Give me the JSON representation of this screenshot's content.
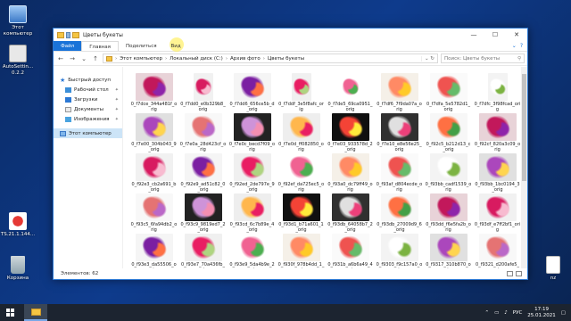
{
  "desktop": {
    "icons": [
      {
        "label": "Этот компьютер"
      },
      {
        "label": "AutoSettin... 0.2.2"
      },
      {
        "label": "TS.21.1.144..."
      },
      {
        "label": "Корзина"
      },
      {
        "label": "nz"
      }
    ]
  },
  "window": {
    "title": "Цветы букеты",
    "controls": {
      "minimize": "—",
      "maximize": "☐",
      "close": "✕"
    },
    "ribbon_tabs": [
      "Файл",
      "Главная",
      "Поделиться",
      "Вид"
    ],
    "address": {
      "segments": [
        "Этот компьютер",
        "Локальный диск (C:)",
        "Архив фото",
        "Цветы букеты"
      ],
      "separator": "›"
    },
    "search": {
      "placeholder": "Поиск: Цветы букеты"
    },
    "nav": {
      "quick_access": "Быстрый доступ",
      "items": [
        "Рабочий стол",
        "Загрузки",
        "Документы",
        "Изображения"
      ],
      "this_pc": "Этот компьютер"
    },
    "files": [
      "0_f7dce_344a481f_orig",
      "0_f7dd0_e0b329b8_orig",
      "0_f7dd6_656ce5b_d_orig",
      "0_f7ddf_3e5f8afc_orig",
      "0_f7de5_69ca0951_orig",
      "0_f7df6_7f9da07a_orig",
      "0_f7dfa_5e5782d1_orig",
      "0_f7dfc_3f98fcad_orig",
      "0_f7e00_304b043_9_orig",
      "0_f7e0a_28d423cf_orig",
      "0_f7e0c_becd7f09_orig",
      "0_f7e0d_ff082850_orig",
      "0_f7e03_933578d_2_orig",
      "0_f7e10_e8e56e25_orig",
      "0_f92c5_b212d13_c_orig",
      "0_f92cf_820a3c09_orig",
      "0_f92e3_cb2a691_b_orig",
      "0_f92e9_ad51c82_0_orig",
      "0_f92ed_2de797e_9_orig",
      "0_f92ef_da725ec5_orig",
      "0_f93a0_dc79ff49_orig",
      "0_f93af_d804ecde_orig",
      "0_f93bb_cadf1539_orig",
      "0_f93bb_1bc0194_3_orig",
      "0_f93c5_6fa94db2_orig",
      "0_f93c9_9819ed7_2_orig",
      "0_f93cd_6c7b89e_4_orig",
      "0_f93d1_b71a601_1_orig",
      "0_f93db_64058b7_2_orig",
      "0_f93db_27009d9_6_orig",
      "0_f93dd_f6e5fa2b_orig",
      "0_f93df_e7ff2bf1_orig",
      "0_f93e3_da55506_orig",
      "0_f93e7_70a436fb_orig",
      "0_f93e9_5da4b9e_2_orig",
      "0_f930f_978b4dd_1_orig",
      "0_f931b_a6b6a49_4_orig",
      "0_f9303_f9c157a0_orig",
      "0_f9317_310b870_orig",
      "0_f9321_d200afe5_orig"
    ],
    "status": "Элементов: 62"
  },
  "taskbar": {
    "lang": "РУС",
    "time": "17:19",
    "date": "25.01.2021"
  },
  "colors": {
    "accent": "#2b78d4",
    "file_tab": "#1a73d8",
    "taskbar": "#1c2430"
  }
}
